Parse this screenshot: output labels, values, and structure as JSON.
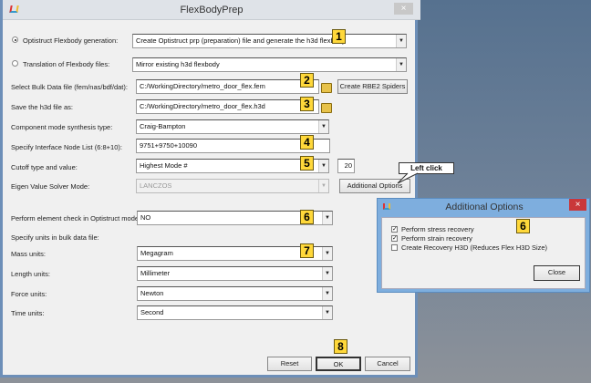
{
  "window": {
    "title": "FlexBodyPrep",
    "close": "×"
  },
  "rows": {
    "opt_gen": {
      "label": "Optistruct Flexbody generation:",
      "value": "Create Optistruct prp (preparation) file and generate the h3d flexbody",
      "selected": true
    },
    "translation": {
      "label": "Translation of Flexbody files:",
      "value": "Mirror existing h3d flexbody",
      "selected": false
    },
    "bulk": {
      "label": "Select Bulk Data file (fem/nas/bdf/dat):",
      "value": "C:/WorkingDirectory/metro_door_flex.fem",
      "button": "Create RBE2 Spiders"
    },
    "save": {
      "label": "Save the h3d file as:",
      "value": "C:/WorkingDirectory/metro_door_flex.h3d"
    },
    "cms": {
      "label": "Component mode synthesis type:",
      "value": "Craig-Bampton"
    },
    "nodes": {
      "label": "Specify Interface Node List (6:8+10):",
      "value": "9751+9750+10090"
    },
    "cutoff": {
      "label": "Cutoff type and value:",
      "value": "Highest Mode #",
      "number": "20"
    },
    "eigen": {
      "label": "Eigen Value Solver Mode:",
      "value": "LANCZOS",
      "button": "Additional Options"
    },
    "elemcheck": {
      "label": "Perform element check in Optistruct model:",
      "value": "NO"
    },
    "units_heading": "Specify units in bulk data file:",
    "mass": {
      "label": "Mass units:",
      "value": "Megagram"
    },
    "length": {
      "label": "Length units:",
      "value": "Millimeter"
    },
    "force": {
      "label": "Force units:",
      "value": "Newton"
    },
    "time": {
      "label": "Time units:",
      "value": "Second"
    }
  },
  "buttons": {
    "reset": "Reset",
    "ok": "OK",
    "cancel": "Cancel"
  },
  "callout": "Left click",
  "badges": [
    "1",
    "2",
    "3",
    "4",
    "5",
    "6",
    "7",
    "8",
    "6"
  ],
  "additional": {
    "title": "Additional Options",
    "close_x": "×",
    "options": [
      {
        "label": "Perform stress recovery",
        "checked": true
      },
      {
        "label": "Perform strain recovery",
        "checked": true
      },
      {
        "label": "Create Recovery H3D (Reduces Flex H3D Size)",
        "checked": false
      }
    ],
    "close": "Close"
  }
}
